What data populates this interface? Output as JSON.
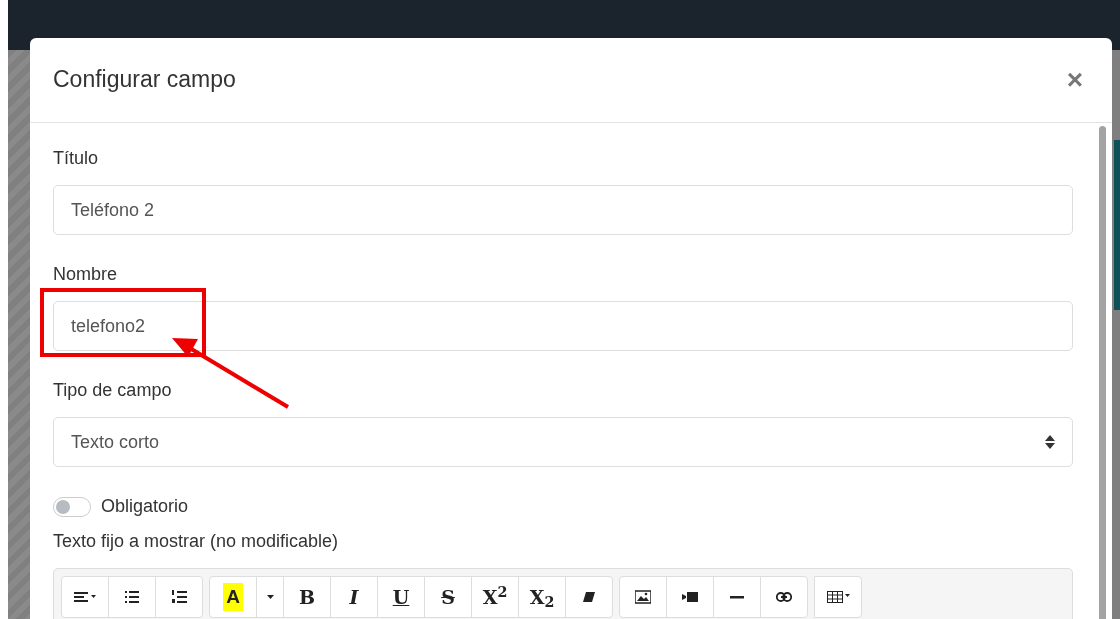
{
  "modal": {
    "title": "Configurar campo",
    "close": "×"
  },
  "fields": [
    {
      "kind": "input",
      "label": "Título",
      "value": "Teléfono 2",
      "highlighted": false
    },
    {
      "kind": "input",
      "label": "Nombre",
      "value": "telefono2",
      "highlighted": true
    },
    {
      "kind": "select",
      "label": "Tipo de campo",
      "value": "Texto corto",
      "highlighted": false
    }
  ],
  "toggle": {
    "label": "Obligatorio",
    "on": false
  },
  "editor": {
    "label": "Texto fijo a mostrar (no modificable)",
    "toolbar": [
      [
        {
          "kind": "align"
        },
        {
          "kind": "ul"
        },
        {
          "kind": "ol"
        }
      ],
      [
        {
          "kind": "color",
          "label": "A"
        },
        {
          "kind": "caret"
        },
        {
          "kind": "bold",
          "label": "B"
        },
        {
          "kind": "italic",
          "label": "I"
        },
        {
          "kind": "underline",
          "label": "U"
        },
        {
          "kind": "strike",
          "label": "S"
        },
        {
          "kind": "sup",
          "label": "X$^{2}$"
        },
        {
          "kind": "sub",
          "label": "X$_{2}$"
        },
        {
          "kind": "eraser"
        }
      ],
      [
        {
          "kind": "picture"
        },
        {
          "kind": "video"
        },
        {
          "kind": "hr"
        },
        {
          "kind": "link"
        }
      ],
      [
        {
          "kind": "table"
        }
      ]
    ]
  }
}
